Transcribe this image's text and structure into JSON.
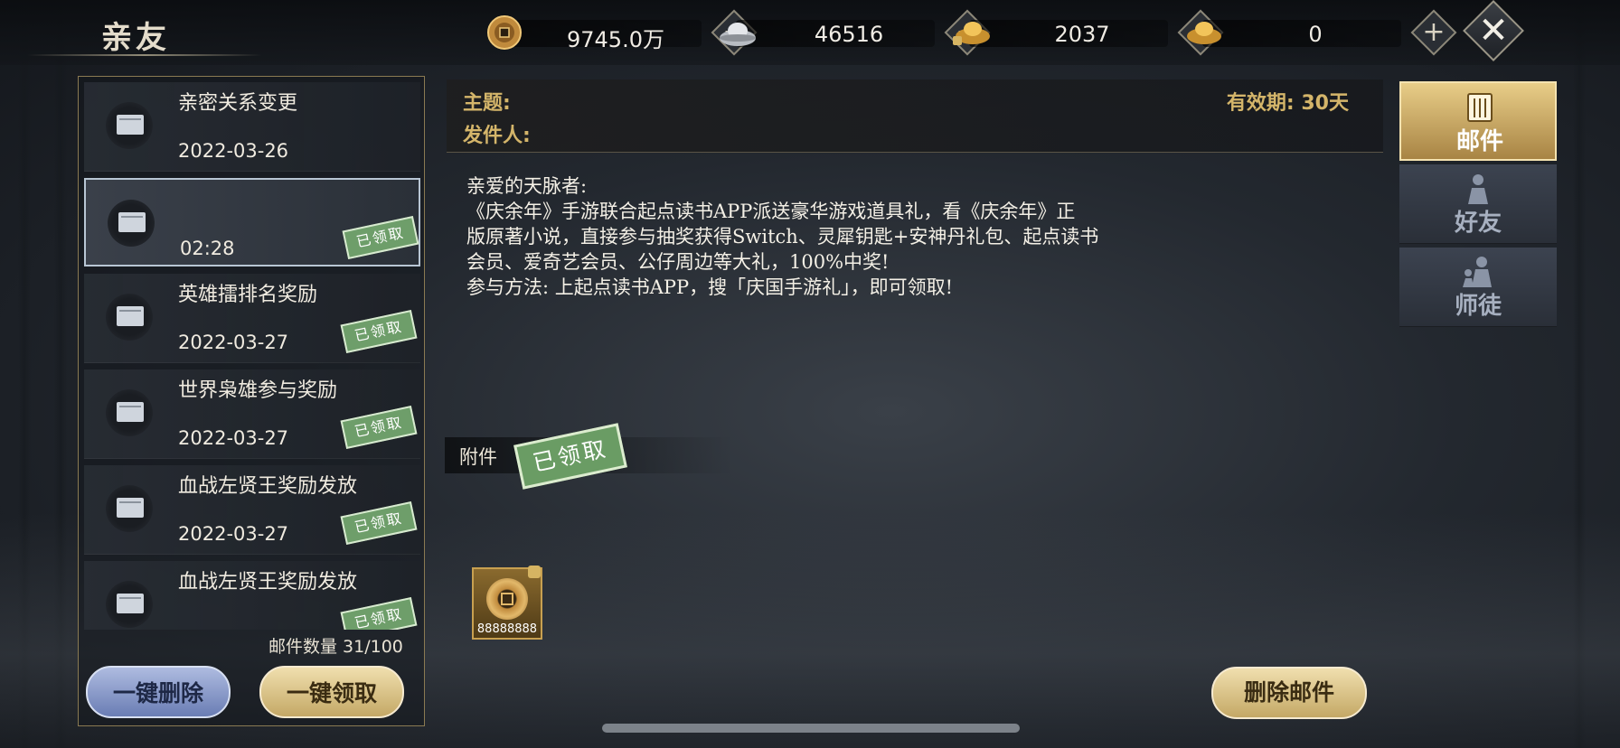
{
  "header": {
    "title": "亲友",
    "currencies": [
      {
        "icon": "copper-coin-icon",
        "value": "9745.0万"
      },
      {
        "icon": "silver-ingot-icon",
        "value": "46516"
      },
      {
        "icon": "locked-gold-ingot-icon",
        "value": "2037"
      },
      {
        "icon": "gold-ingot-icon",
        "value": "0"
      }
    ],
    "plus_label": "+",
    "close_label": "✕"
  },
  "mail_list": {
    "items": [
      {
        "title": "亲密关系变更",
        "date": "2022-03-26",
        "claimed": false,
        "selected": false
      },
      {
        "title": "",
        "date": "02:28",
        "claimed": true,
        "selected": true
      },
      {
        "title": "英雄擂排名奖励",
        "date": "2022-03-27",
        "claimed": true,
        "selected": false
      },
      {
        "title": "世界枭雄参与奖励",
        "date": "2022-03-27",
        "claimed": true,
        "selected": false
      },
      {
        "title": "血战左贤王奖励发放",
        "date": "2022-03-27",
        "claimed": true,
        "selected": false
      },
      {
        "title": "血战左贤王奖励发放",
        "date": "",
        "claimed": true,
        "selected": false
      }
    ],
    "stamp_label": "已领取",
    "count": "邮件数量 31/100",
    "delete_all": "一键删除",
    "claim_all": "一键领取"
  },
  "mail_detail": {
    "subject_label": "主题:",
    "sender_label": "发件人:",
    "validity": "有效期: 30天",
    "body": [
      "亲爱的天脉者:",
      "《庆余年》手游联合起点读书APP派送豪华游戏道具礼，看《庆余年》正",
      "版原著小说，直接参与抽奖获得Switch、灵犀钥匙+安神丹礼包、起点读书",
      "会员、爱奇艺会员、公仔周边等大礼，100%中奖!",
      "参与方法: 上起点读书APP，搜「庆国手游礼」，即可领取!"
    ],
    "attachment_label": "附件",
    "attachment_stamp": "已领取",
    "attachment_item": {
      "icon": "copper-coin-icon",
      "quantity": "88888888",
      "locked": true
    },
    "delete_button": "删除邮件"
  },
  "tabs": [
    {
      "label": "邮件",
      "icon": "mail-scroll-icon",
      "active": true
    },
    {
      "label": "好友",
      "icon": "friend-figure-icon",
      "active": false
    },
    {
      "label": "师徒",
      "icon": "master-apprentice-icon",
      "active": false
    }
  ],
  "colors": {
    "gold_label": "#d4b56a",
    "stamp_green": "#6e9e6a",
    "active_tab": "#e8cd88"
  }
}
